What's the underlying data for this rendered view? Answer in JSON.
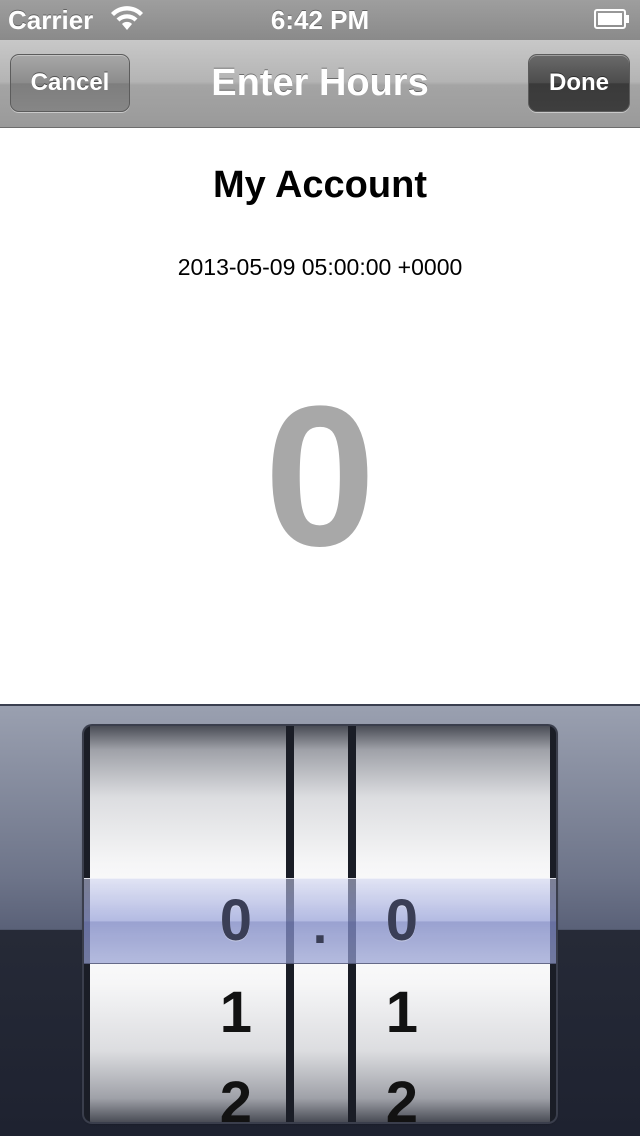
{
  "status_bar": {
    "carrier": "Carrier",
    "time": "6:42 PM",
    "icons": [
      "wifi-icon",
      "battery-icon"
    ]
  },
  "nav_bar": {
    "cancel_label": "Cancel",
    "title": "Enter Hours",
    "done_label": "Done"
  },
  "content": {
    "account_title": "My Account",
    "date": "2013-05-09 05:00:00 +0000",
    "value": "0"
  },
  "picker": {
    "left_column": {
      "selected": "0",
      "rows_below": [
        "1",
        "2"
      ]
    },
    "separator": ".",
    "right_column": {
      "selected": "0",
      "rows_below": [
        "1",
        "2"
      ]
    }
  },
  "colors": {
    "value_text": "#a8a8a8",
    "selection_tint": "#9aa2d6"
  }
}
